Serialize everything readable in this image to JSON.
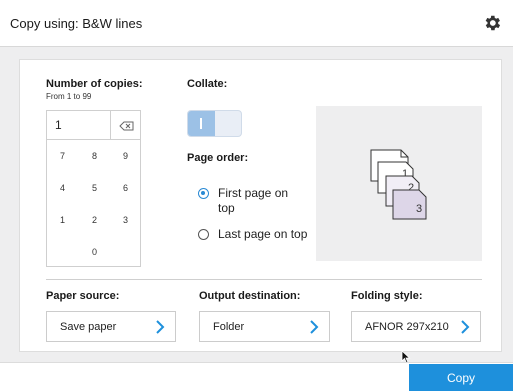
{
  "header": {
    "title": "Copy using: B&W lines"
  },
  "copies": {
    "label": "Number of copies:",
    "range": "From 1 to 99",
    "value": "1",
    "keys": [
      "7",
      "8",
      "9",
      "4",
      "5",
      "6",
      "1",
      "2",
      "3",
      "0"
    ]
  },
  "collate": {
    "label": "Collate:",
    "enabled": true
  },
  "page_order": {
    "label": "Page order:",
    "options": [
      {
        "label": "First page on top",
        "selected": true
      },
      {
        "label": "Last page on top",
        "selected": false
      }
    ]
  },
  "preview": {
    "pages": [
      "1",
      "2",
      "3"
    ]
  },
  "paper_source": {
    "label": "Paper source:",
    "value": "Save paper"
  },
  "output_destination": {
    "label": "Output destination:",
    "value": "Folder"
  },
  "folding_style": {
    "label": "Folding style:",
    "value": "AFNOR 297x210"
  },
  "footer": {
    "copy_label": "Copy"
  },
  "colors": {
    "accent": "#1e90dc",
    "toggle_on": "#9cc1e6"
  }
}
